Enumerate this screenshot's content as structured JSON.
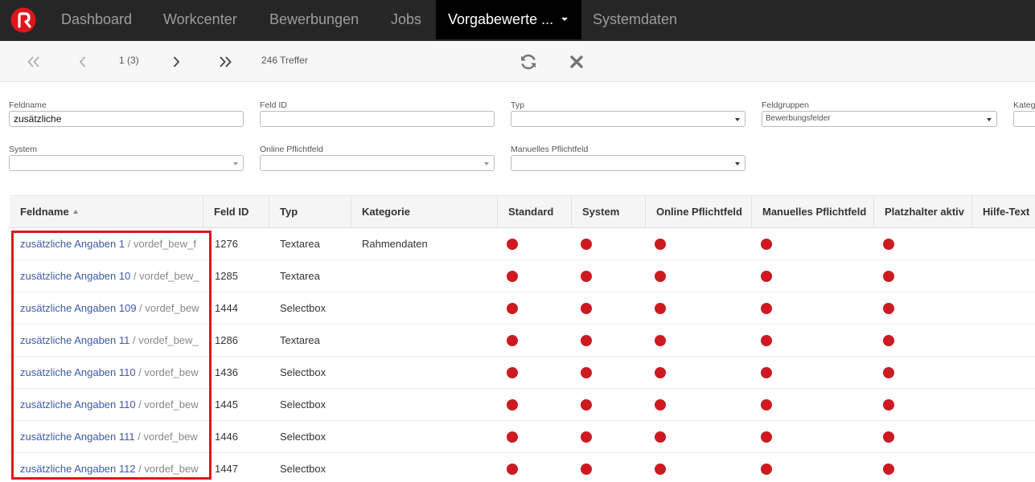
{
  "nav": {
    "items": [
      "Dashboard",
      "Workcenter",
      "Bewerbungen",
      "Jobs",
      "Vorgabewerte ...",
      "Systemdaten"
    ],
    "active_index": 4,
    "logo_icon": "brand-logo-icon",
    "bg_color": "#262626",
    "active_bg_color": "#000000"
  },
  "toolbar": {
    "page_info": "1 (3)",
    "result_count": "246 Treffer",
    "icons": [
      "first-page-icon",
      "previous-page-icon",
      "next-page-icon",
      "last-page-icon",
      "refresh-icon",
      "close-icon"
    ]
  },
  "filters": {
    "feldname": {
      "label": "Feldname",
      "value": "zusätzliche"
    },
    "feld_id": {
      "label": "Feld ID",
      "value": ""
    },
    "typ": {
      "label": "Typ",
      "value": ""
    },
    "feldgruppen": {
      "label": "Feldgruppen",
      "value": "Bewerbungsfelder"
    },
    "kategorie": {
      "label": "Katego"
    },
    "system": {
      "label": "System",
      "value": ""
    },
    "online_pflichtfeld": {
      "label": "Online Pflichtfeld",
      "value": ""
    },
    "manuelles_pflichtfeld": {
      "label": "Manuelles Pflichtfeld",
      "value": ""
    }
  },
  "table": {
    "columns": [
      "Feldname",
      "Feld ID",
      "Typ",
      "Kategorie",
      "Standard",
      "System",
      "Online Pflichtfeld",
      "Manuelles Pflichtfeld",
      "Platzhalter aktiv",
      "Hilfe-Text"
    ],
    "sort_column": "Feldname",
    "sort_direction": "ascending",
    "status_dot_color": "#cc1a22",
    "rows": [
      {
        "name": "zusätzliche Angaben 1",
        "suffix": " / vordef_bew_f",
        "id": "1276",
        "typ": "Textarea",
        "kategorie": "Rahmendaten"
      },
      {
        "name": "zusätzliche Angaben 10",
        "suffix": " / vordef_bew_",
        "id": "1285",
        "typ": "Textarea",
        "kategorie": ""
      },
      {
        "name": "zusätzliche Angaben 109",
        "suffix": " / vordef_bew",
        "id": "1444",
        "typ": "Selectbox",
        "kategorie": ""
      },
      {
        "name": "zusätzliche Angaben 11",
        "suffix": " / vordef_bew_",
        "id": "1286",
        "typ": "Textarea",
        "kategorie": ""
      },
      {
        "name": "zusätzliche Angaben 110",
        "suffix": " / vordef_bew",
        "id": "1436",
        "typ": "Selectbox",
        "kategorie": ""
      },
      {
        "name": "zusätzliche Angaben 110",
        "suffix": " / vordef_bew",
        "id": "1445",
        "typ": "Selectbox",
        "kategorie": ""
      },
      {
        "name": "zusätzliche Angaben 111",
        "suffix": " / vordef_bew",
        "id": "1446",
        "typ": "Selectbox",
        "kategorie": ""
      },
      {
        "name": "zusätzliche Angaben 112",
        "suffix": " / vordef_bew",
        "id": "1447",
        "typ": "Selectbox",
        "kategorie": ""
      }
    ]
  },
  "highlight_color": "#e0141c"
}
